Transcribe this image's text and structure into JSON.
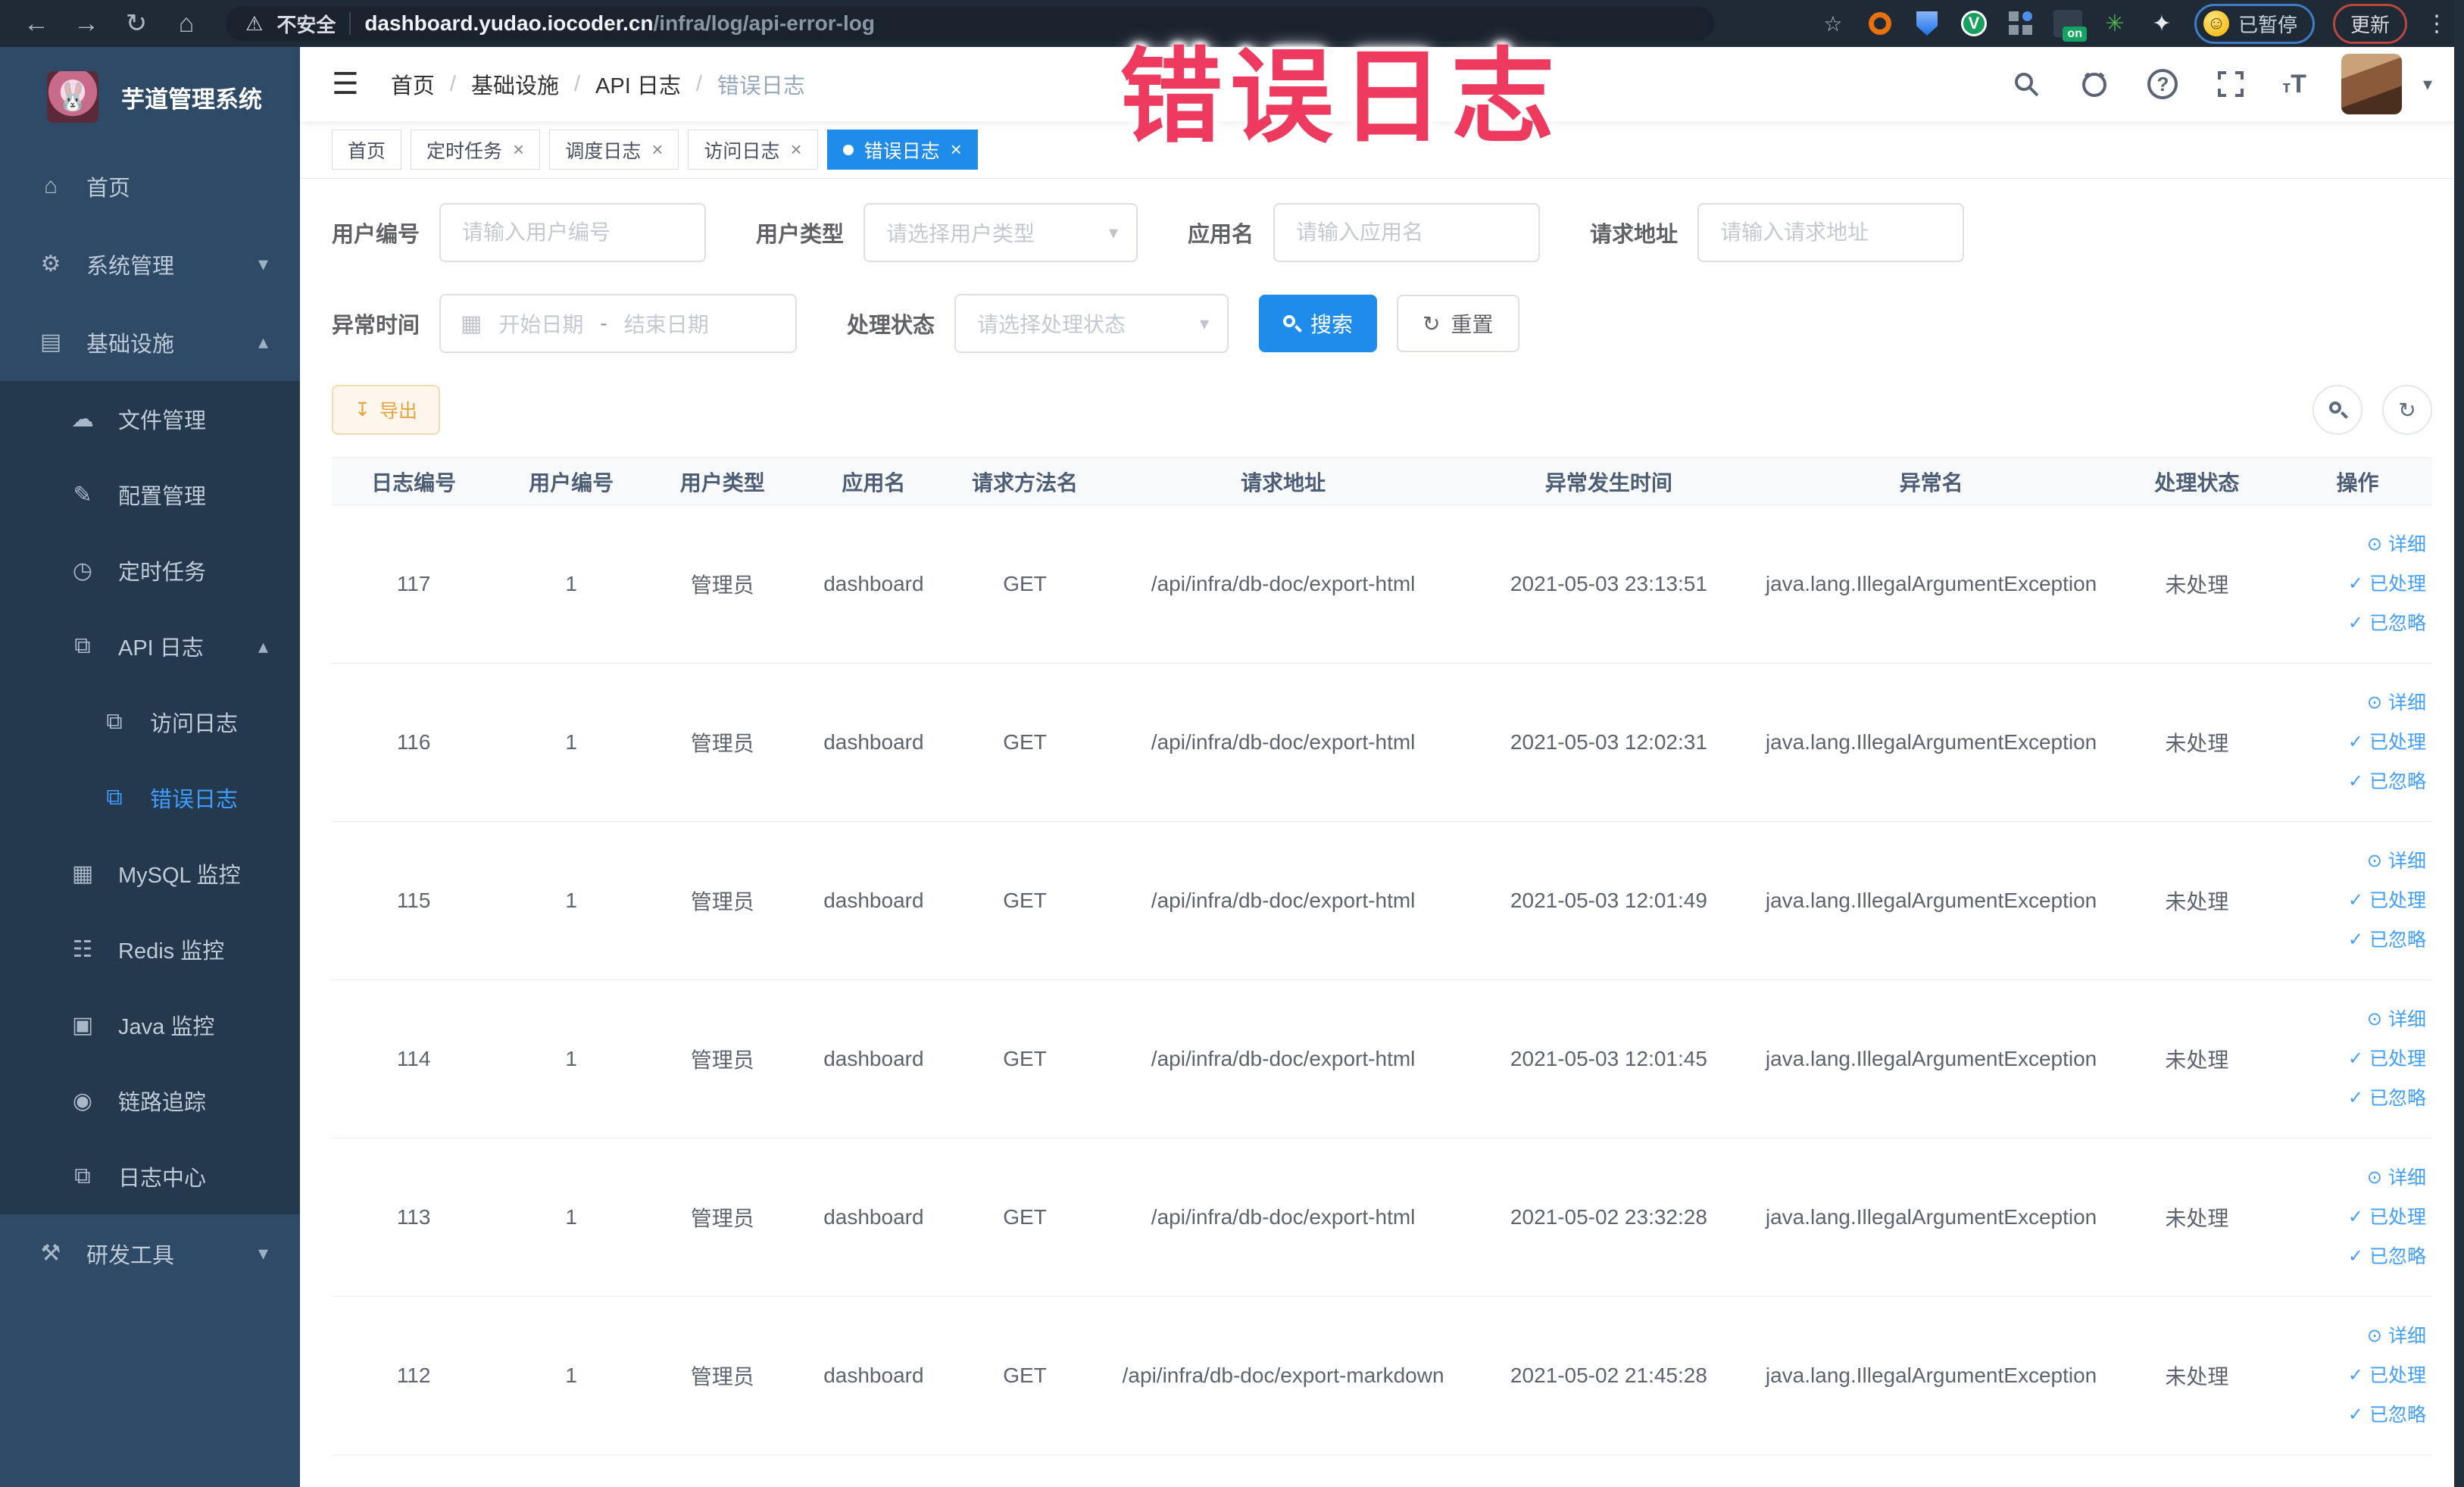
{
  "overlay": {
    "text": "错误日志"
  },
  "colors": {
    "accent": "#1f8ceb",
    "link": "#409eff",
    "warning": "#e6a23c",
    "overlay_red": "#ee3a5e",
    "sidebar_bg": "#2e4a66",
    "submenu_bg": "#24384e"
  },
  "browser": {
    "security_label": "不安全",
    "url_host": "dashboard.yudao.iocoder.cn",
    "url_path": "/infra/log/api-error-log",
    "extension_on_badge": "on",
    "paused_pill": "已暂停",
    "update_pill": "更新"
  },
  "sidebar": {
    "title": "芋道管理系统",
    "items": [
      {
        "id": "home",
        "label": "首页",
        "icon": "home-icon",
        "glyph": "⌂",
        "level": 0,
        "sub": false
      },
      {
        "id": "system-mgmt",
        "label": "系统管理",
        "icon": "gear-icon",
        "glyph": "⚙",
        "level": 0,
        "sub": false,
        "chevron": "down"
      },
      {
        "id": "infrastructure",
        "label": "基础设施",
        "icon": "monitor-icon",
        "glyph": "▤",
        "level": 0,
        "sub": false,
        "chevron": "up"
      },
      {
        "id": "file-mgmt",
        "label": "文件管理",
        "icon": "cloud-upload-icon",
        "glyph": "☁",
        "level": 1,
        "sub": true
      },
      {
        "id": "config-mgmt",
        "label": "配置管理",
        "icon": "edit-icon",
        "glyph": "✎",
        "level": 1,
        "sub": true
      },
      {
        "id": "cron-job",
        "label": "定时任务",
        "icon": "clock-icon",
        "glyph": "◷",
        "level": 1,
        "sub": true
      },
      {
        "id": "api-log",
        "label": "API 日志",
        "icon": "log-edit-icon",
        "glyph": "⧉",
        "level": 1,
        "sub": true,
        "chevron": "up"
      },
      {
        "id": "access-log",
        "label": "访问日志",
        "icon": "log-edit-icon",
        "glyph": "⧉",
        "level": 2,
        "sub": true
      },
      {
        "id": "error-log",
        "label": "错误日志",
        "icon": "log-edit-icon",
        "glyph": "⧉",
        "level": 2,
        "sub": true,
        "active": true
      },
      {
        "id": "mysql-monitor",
        "label": "MySQL 监控",
        "icon": "mysql-icon",
        "glyph": "▦",
        "level": 1,
        "sub": true
      },
      {
        "id": "redis-monitor",
        "label": "Redis 监控",
        "icon": "redis-icon",
        "glyph": "☷",
        "level": 1,
        "sub": true
      },
      {
        "id": "java-monitor",
        "label": "Java 监控",
        "icon": "java-icon",
        "glyph": "▣",
        "level": 1,
        "sub": true
      },
      {
        "id": "trace",
        "label": "链路追踪",
        "icon": "eye-icon",
        "glyph": "◉",
        "level": 1,
        "sub": true
      },
      {
        "id": "log-center",
        "label": "日志中心",
        "icon": "log-center-icon",
        "glyph": "⧉",
        "level": 1,
        "sub": true
      },
      {
        "id": "dev-tools",
        "label": "研发工具",
        "icon": "tools-icon",
        "glyph": "⚒",
        "level": 0,
        "sub": false,
        "chevron": "down"
      }
    ]
  },
  "breadcrumb": {
    "items": [
      "首页",
      "基础设施",
      "API 日志",
      "错误日志"
    ]
  },
  "tabs": [
    {
      "label": "首页",
      "closable": false,
      "active": false
    },
    {
      "label": "定时任务",
      "closable": true,
      "active": false
    },
    {
      "label": "调度日志",
      "closable": true,
      "active": false
    },
    {
      "label": "访问日志",
      "closable": true,
      "active": false
    },
    {
      "label": "错误日志",
      "closable": true,
      "active": true
    }
  ],
  "filters": {
    "user_id": {
      "label": "用户编号",
      "placeholder": "请输入用户编号"
    },
    "user_type": {
      "label": "用户类型",
      "placeholder": "请选择用户类型"
    },
    "app_name": {
      "label": "应用名",
      "placeholder": "请输入应用名"
    },
    "request_url": {
      "label": "请求地址",
      "placeholder": "请输入请求地址"
    },
    "exception_time": {
      "label": "异常时间",
      "start_placeholder": "开始日期",
      "separator": "-",
      "end_placeholder": "结束日期"
    },
    "process_status": {
      "label": "处理状态",
      "placeholder": "请选择处理状态"
    },
    "search_button": "搜索",
    "reset_button": "重置"
  },
  "toolbar": {
    "export_button": "导出"
  },
  "table": {
    "columns": [
      "日志编号",
      "用户编号",
      "用户类型",
      "应用名",
      "请求方法名",
      "请求地址",
      "异常发生时间",
      "异常名",
      "处理状态",
      "操作"
    ],
    "actions": [
      "详细",
      "已处理",
      "已忽略"
    ],
    "rows": [
      {
        "id": "117",
        "user_id": "1",
        "user_type": "管理员",
        "app": "dashboard",
        "method": "GET",
        "url": "/api/infra/db-doc/export-html",
        "time": "2021-05-03 23:13:51",
        "exception": "java.lang.IllegalArgumentException",
        "status": "未处理"
      },
      {
        "id": "116",
        "user_id": "1",
        "user_type": "管理员",
        "app": "dashboard",
        "method": "GET",
        "url": "/api/infra/db-doc/export-html",
        "time": "2021-05-03 12:02:31",
        "exception": "java.lang.IllegalArgumentException",
        "status": "未处理"
      },
      {
        "id": "115",
        "user_id": "1",
        "user_type": "管理员",
        "app": "dashboard",
        "method": "GET",
        "url": "/api/infra/db-doc/export-html",
        "time": "2021-05-03 12:01:49",
        "exception": "java.lang.IllegalArgumentException",
        "status": "未处理"
      },
      {
        "id": "114",
        "user_id": "1",
        "user_type": "管理员",
        "app": "dashboard",
        "method": "GET",
        "url": "/api/infra/db-doc/export-html",
        "time": "2021-05-03 12:01:45",
        "exception": "java.lang.IllegalArgumentException",
        "status": "未处理"
      },
      {
        "id": "113",
        "user_id": "1",
        "user_type": "管理员",
        "app": "dashboard",
        "method": "GET",
        "url": "/api/infra/db-doc/export-html",
        "time": "2021-05-02 23:32:28",
        "exception": "java.lang.IllegalArgumentException",
        "status": "未处理"
      },
      {
        "id": "112",
        "user_id": "1",
        "user_type": "管理员",
        "app": "dashboard",
        "method": "GET",
        "url": "/api/infra/db-doc/export-markdown",
        "time": "2021-05-02 21:45:28",
        "exception": "java.lang.IllegalArgumentException",
        "status": "未处理"
      }
    ]
  }
}
